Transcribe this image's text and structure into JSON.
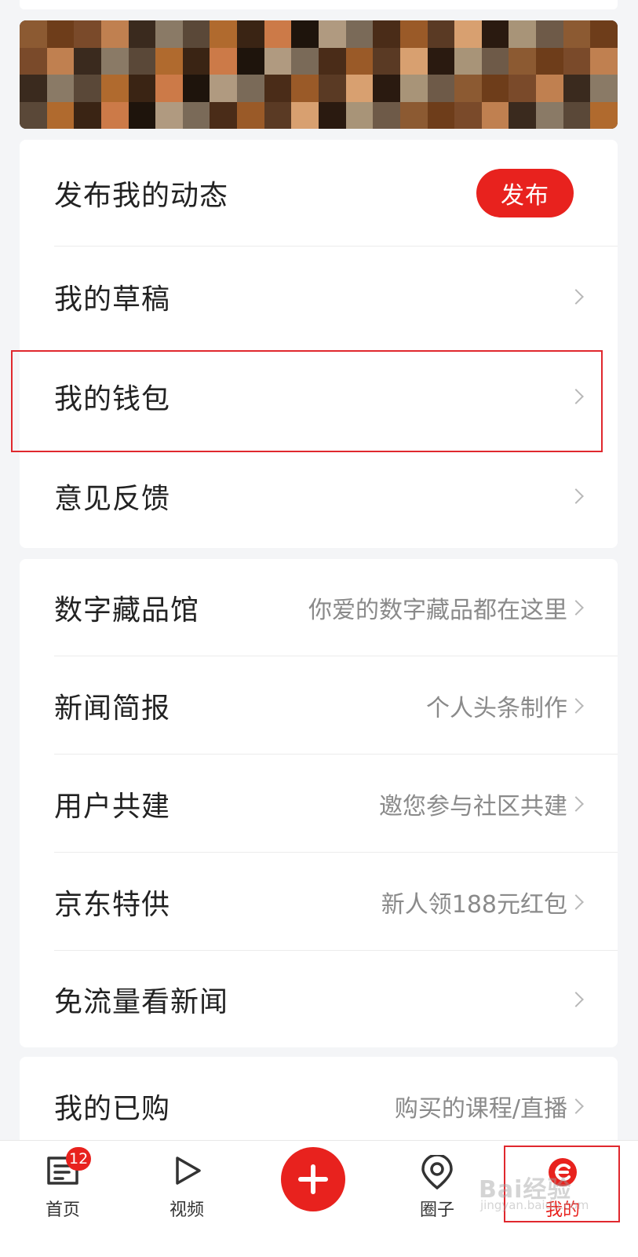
{
  "publish_section": {
    "title": "发布我的动态",
    "button_label": "发布"
  },
  "menu_group_1": [
    {
      "label": "我的草稿"
    },
    {
      "label": "我的钱包"
    },
    {
      "label": "意见反馈"
    }
  ],
  "menu_group_2": [
    {
      "label": "数字藏品馆",
      "hint": "你爱的数字藏品都在这里"
    },
    {
      "label": "新闻简报",
      "hint": "个人头条制作"
    },
    {
      "label": "用户共建",
      "hint": "邀您参与社区共建"
    },
    {
      "label": "京东特供",
      "hint": "新人领188元红包"
    },
    {
      "label": "免流量看新闻",
      "hint": ""
    }
  ],
  "menu_group_3": [
    {
      "label": "我的已购",
      "hint": "购买的课程/直播"
    }
  ],
  "tabbar": {
    "home_label": "首页",
    "home_badge": "12",
    "video_label": "视频",
    "circle_label": "圈子",
    "mine_label": "我的"
  },
  "watermark": {
    "text": "Bai经验",
    "sub": "jingyan.baidu.com"
  },
  "colors": {
    "accent": "#e8221e",
    "highlight_border": "#e0282e"
  }
}
